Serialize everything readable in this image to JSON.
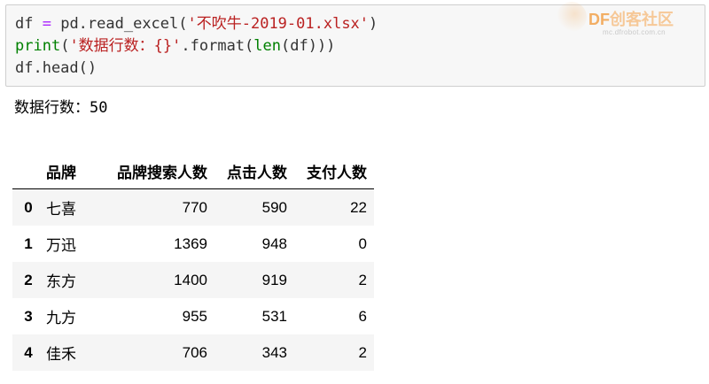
{
  "code_cell": {
    "lines": [
      [
        {
          "text": "df ",
          "style": "plain"
        },
        {
          "text": "=",
          "style": "op"
        },
        {
          "text": " pd.read_excel(",
          "style": "plain"
        },
        {
          "text": "'不吹牛-2019-01.xlsx'",
          "style": "str"
        },
        {
          "text": ")",
          "style": "plain"
        }
      ],
      [
        {
          "text": "print",
          "style": "kw"
        },
        {
          "text": "(",
          "style": "plain"
        },
        {
          "text": "'数据行数：{}'",
          "style": "str"
        },
        {
          "text": ".format(",
          "style": "plain"
        },
        {
          "text": "len",
          "style": "kw"
        },
        {
          "text": "(df)))",
          "style": "plain"
        }
      ],
      [
        {
          "text": "df.head()",
          "style": "plain"
        }
      ]
    ]
  },
  "watermark": {
    "logo": "DF",
    "logo_sub": "创客社区",
    "url": "mc.dfrobot.com.cn"
  },
  "output": {
    "text": "数据行数：50"
  },
  "table": {
    "columns": [
      "",
      "品牌",
      "品牌搜索人数",
      "点击人数",
      "支付人数"
    ],
    "rows": [
      {
        "index": "0",
        "brand": "七喜",
        "search": "770",
        "click": "590",
        "pay": "22"
      },
      {
        "index": "1",
        "brand": "万迅",
        "search": "1369",
        "click": "948",
        "pay": "0"
      },
      {
        "index": "2",
        "brand": "东方",
        "search": "1400",
        "click": "919",
        "pay": "2"
      },
      {
        "index": "3",
        "brand": "九方",
        "search": "955",
        "click": "531",
        "pay": "6"
      },
      {
        "index": "4",
        "brand": "佳禾",
        "search": "706",
        "click": "343",
        "pay": "2"
      }
    ]
  },
  "colors": {
    "keyword": "#008000",
    "string": "#ba2121",
    "operator": "#aa22ff",
    "cell_bg": "#f7f7f7",
    "row_stripe": "#f5f5f5"
  }
}
